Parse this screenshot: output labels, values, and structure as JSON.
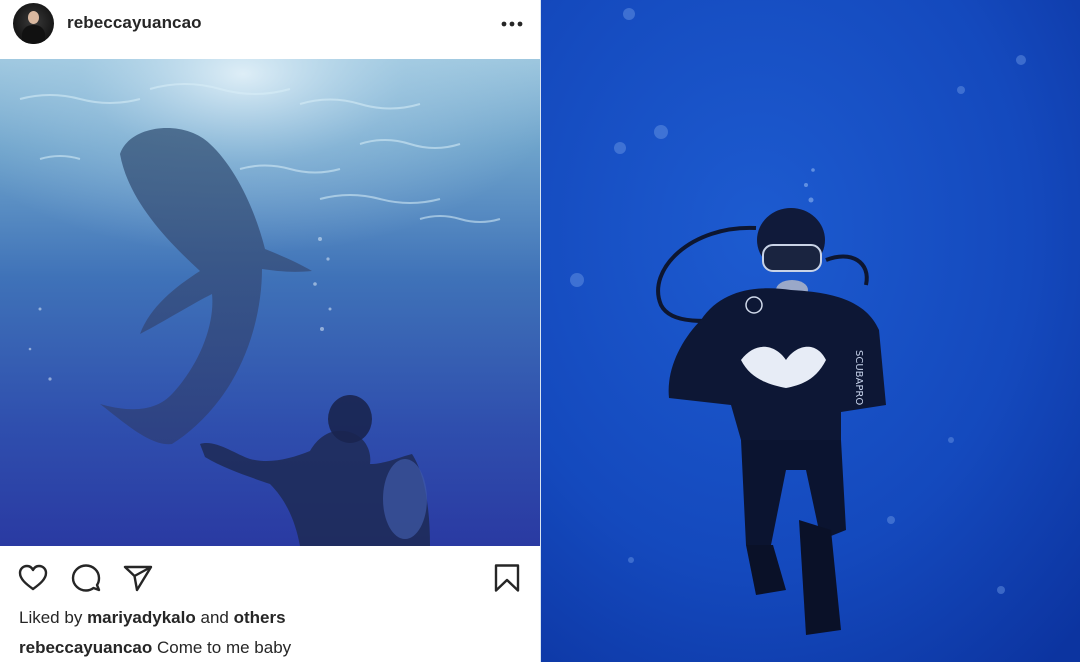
{
  "post": {
    "username": "rebeccayuancao",
    "more_icon": "more-horizontal-icon",
    "photo_description_icon": "whale-shark-photo",
    "actions": {
      "like_icon": "heart-icon",
      "comment_icon": "comment-icon",
      "share_icon": "send-icon",
      "save_icon": "bookmark-icon"
    },
    "likes": {
      "prefix": "Liked by",
      "user": "mariyadykalo",
      "conjunction": "and",
      "others": "others"
    },
    "caption": {
      "username": "rebeccayuancao",
      "text": "Come to me baby"
    }
  },
  "colors": {
    "text": "#262626",
    "ocean_light": "#6fa2c8",
    "ocean_deep": "#2a3fa8",
    "ocean_right": "#1247c0"
  }
}
